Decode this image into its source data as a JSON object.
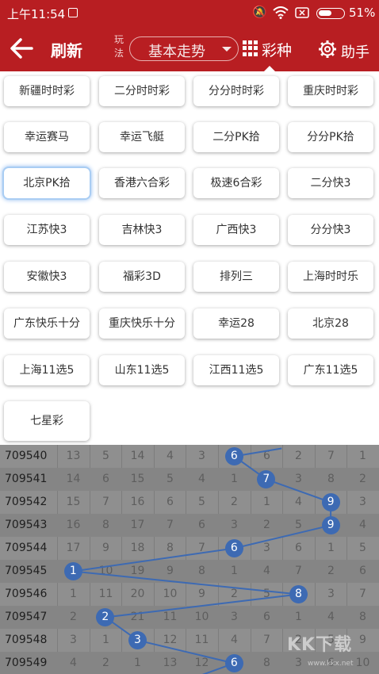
{
  "status_bar": {
    "time": "上午11:54",
    "battery": "51%"
  },
  "toolbar": {
    "refresh_label": "刷新",
    "play_label": "玩法",
    "play_value": "基本走势",
    "lottery_label": "彩种",
    "helper_label": "助手"
  },
  "lottery_types": [
    "新疆时时彩",
    "二分时时彩",
    "分分时时彩",
    "重庆时时彩",
    "幸运赛马",
    "幸运飞艇",
    "二分PK拾",
    "分分PK拾",
    "北京PK拾",
    "香港六合彩",
    "极速6合彩",
    "二分快3",
    "江苏快3",
    "吉林快3",
    "广西快3",
    "分分快3",
    "安徽快3",
    "福彩3D",
    "排列三",
    "上海时时乐",
    "广东快乐十分",
    "重庆快乐十分",
    "幸运28",
    "北京28",
    "上海11选5",
    "山东11选5",
    "江西11选5",
    "广东11选5",
    "七星彩"
  ],
  "selected_lottery": "北京PK拾",
  "chart_rows": [
    {
      "issue": "709540",
      "cells": [
        "13",
        "5",
        "14",
        "4",
        "3",
        "6",
        "6",
        "2",
        "7",
        "1"
      ],
      "hit": 5
    },
    {
      "issue": "709541",
      "cells": [
        "14",
        "6",
        "15",
        "5",
        "4",
        "1",
        "7",
        "3",
        "8",
        "2"
      ],
      "hit": 6
    },
    {
      "issue": "709542",
      "cells": [
        "15",
        "7",
        "16",
        "6",
        "5",
        "2",
        "1",
        "4",
        "9",
        "3"
      ],
      "hit": 8
    },
    {
      "issue": "709543",
      "cells": [
        "16",
        "8",
        "17",
        "7",
        "6",
        "3",
        "2",
        "5",
        "9",
        "4"
      ],
      "hit": 8
    },
    {
      "issue": "709544",
      "cells": [
        "17",
        "9",
        "18",
        "8",
        "7",
        "6",
        "3",
        "6",
        "1",
        "5"
      ],
      "hit": 5
    },
    {
      "issue": "709545",
      "cells": [
        "1",
        "10",
        "19",
        "9",
        "8",
        "1",
        "4",
        "7",
        "2",
        "6"
      ],
      "hit": 0
    },
    {
      "issue": "709546",
      "cells": [
        "1",
        "11",
        "20",
        "10",
        "9",
        "2",
        "5",
        "8",
        "3",
        "7"
      ],
      "hit": 7
    },
    {
      "issue": "709547",
      "cells": [
        "2",
        "2",
        "21",
        "11",
        "10",
        "3",
        "6",
        "1",
        "4",
        "8"
      ],
      "hit": 1
    },
    {
      "issue": "709548",
      "cells": [
        "3",
        "1",
        "3",
        "12",
        "11",
        "4",
        "7",
        "2",
        "5",
        "9"
      ],
      "hit": 2
    },
    {
      "issue": "709549",
      "cells": [
        "4",
        "2",
        "1",
        "13",
        "12",
        "6",
        "8",
        "3",
        "6",
        "10"
      ],
      "hit": 5
    }
  ],
  "watermark": {
    "main": "KK下载",
    "sub": "www.kkx.net"
  },
  "colors": {
    "brand": "#b81e22",
    "ball": "#3d6ab3"
  }
}
